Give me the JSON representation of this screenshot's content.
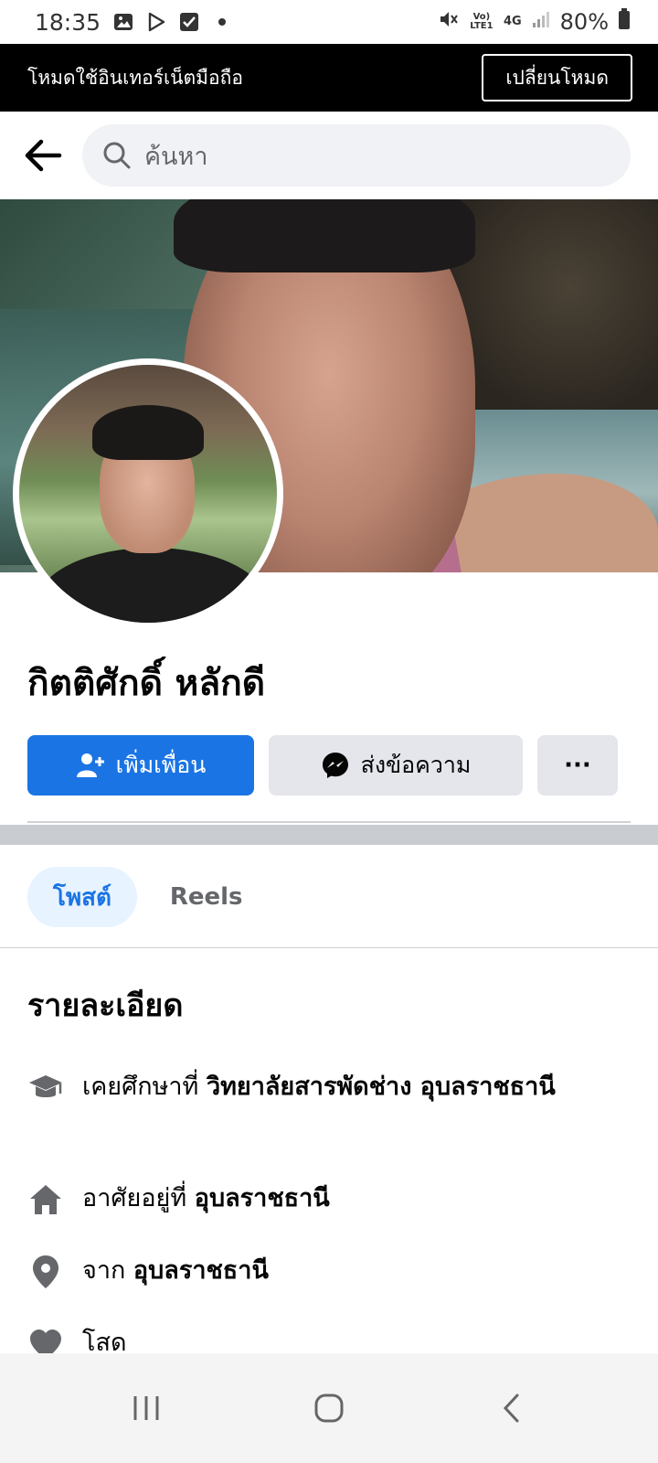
{
  "status_bar": {
    "time": "18:35",
    "battery": "80%",
    "network_label": "4G",
    "volte_label": "Vo) LTE1"
  },
  "mode_bar": {
    "text": "โหมดใช้อินเทอร์เน็ตมือถือ",
    "button": "เปลี่ยนโหมด"
  },
  "search": {
    "placeholder": "ค้นหา"
  },
  "profile": {
    "name": "กิตติศักดิ์ หลักดี",
    "add_friend": "เพิ่มเพื่อน",
    "message": "ส่งข้อความ",
    "more": "···"
  },
  "tabs": [
    {
      "label": "โพสต์",
      "active": true
    },
    {
      "label": "Reels",
      "active": false
    }
  ],
  "details": {
    "title": "รายละเอียด",
    "items": [
      {
        "icon": "graduation-cap-icon",
        "prefix": "เคยศึกษาที่ ",
        "value": "วิทยาลัยสารพัดช่าง อุบลราชธานี"
      },
      {
        "icon": "home-icon",
        "prefix": "อาศัยอยู่ที่ ",
        "value": "อุบลราชธานี"
      },
      {
        "icon": "location-pin-icon",
        "prefix": "จาก ",
        "value": "อุบลราชธานี"
      },
      {
        "icon": "heart-icon",
        "prefix": "โสด",
        "value": ""
      }
    ]
  },
  "colors": {
    "primary": "#1b74e4",
    "tab_active_bg": "#e7f3ff",
    "secondary_button": "#e4e6eb",
    "mode_bar_bg": "#000000"
  }
}
